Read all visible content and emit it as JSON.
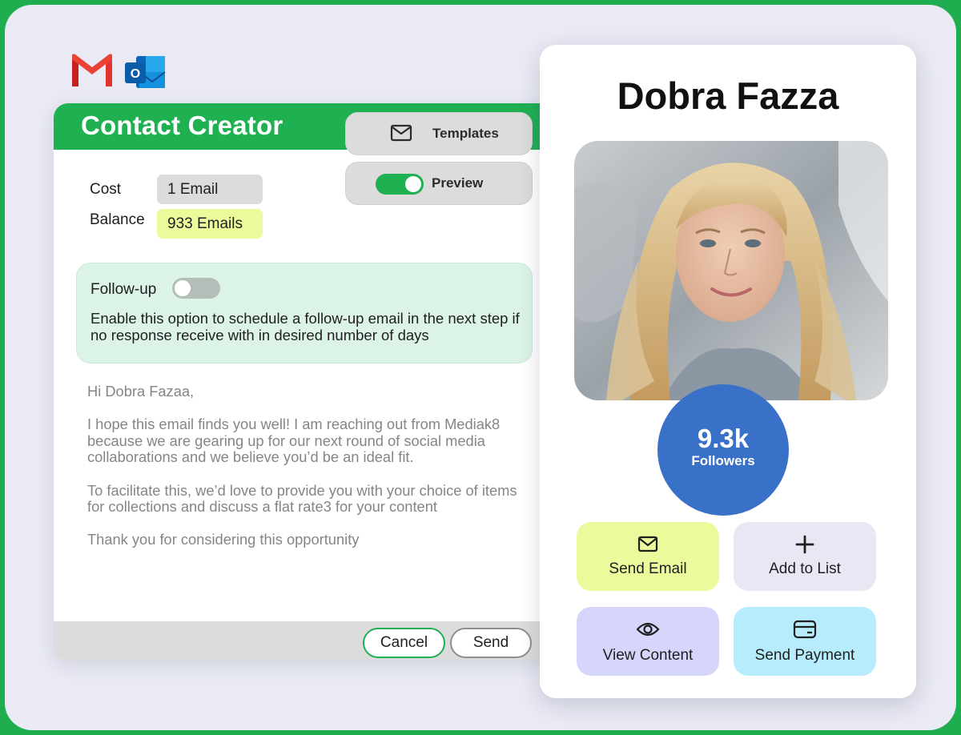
{
  "brands": {
    "gmail_icon": "gmail-icon",
    "outlook_icon": "outlook-icon",
    "outlook_letter": "O"
  },
  "colors": {
    "accent_green": "#1fb052",
    "followers_blue": "#3a71c8",
    "balance_yellow": "#ebfb9c"
  },
  "creator": {
    "title": "Contact Creator",
    "templates_label": "Templates",
    "preview_label": "Preview",
    "preview_enabled": true,
    "cost_label": "Cost",
    "cost_value": "1 Email",
    "balance_label": "Balance",
    "balance_value": "933 Emails",
    "followup": {
      "title": "Follow-up",
      "enabled": false,
      "description": "Enable this option to schedule a follow-up email in the next step if no response receive with in desired number of days"
    },
    "email": {
      "greeting": "Hi Dobra Fazaa,",
      "paragraph1": "I hope this email finds you well! I am reaching out from Mediak8 because we are gearing up for our next round of social media collaborations and we believe you’d be an ideal fit.",
      "paragraph2": "To facilitate this, we’d love to provide you with your choice of items for collections and discuss a flat rate3 for your content",
      "closing": "Thank you for considering this opportunity"
    },
    "cancel_label": "Cancel",
    "send_label": "Send"
  },
  "profile": {
    "name": "Dobra Fazza",
    "followers_count": "9.3k",
    "followers_label": "Followers",
    "actions": {
      "send_email": "Send Email",
      "add_to_list": "Add to List",
      "view_content": "View Content",
      "send_payment": "Send Payment"
    }
  }
}
